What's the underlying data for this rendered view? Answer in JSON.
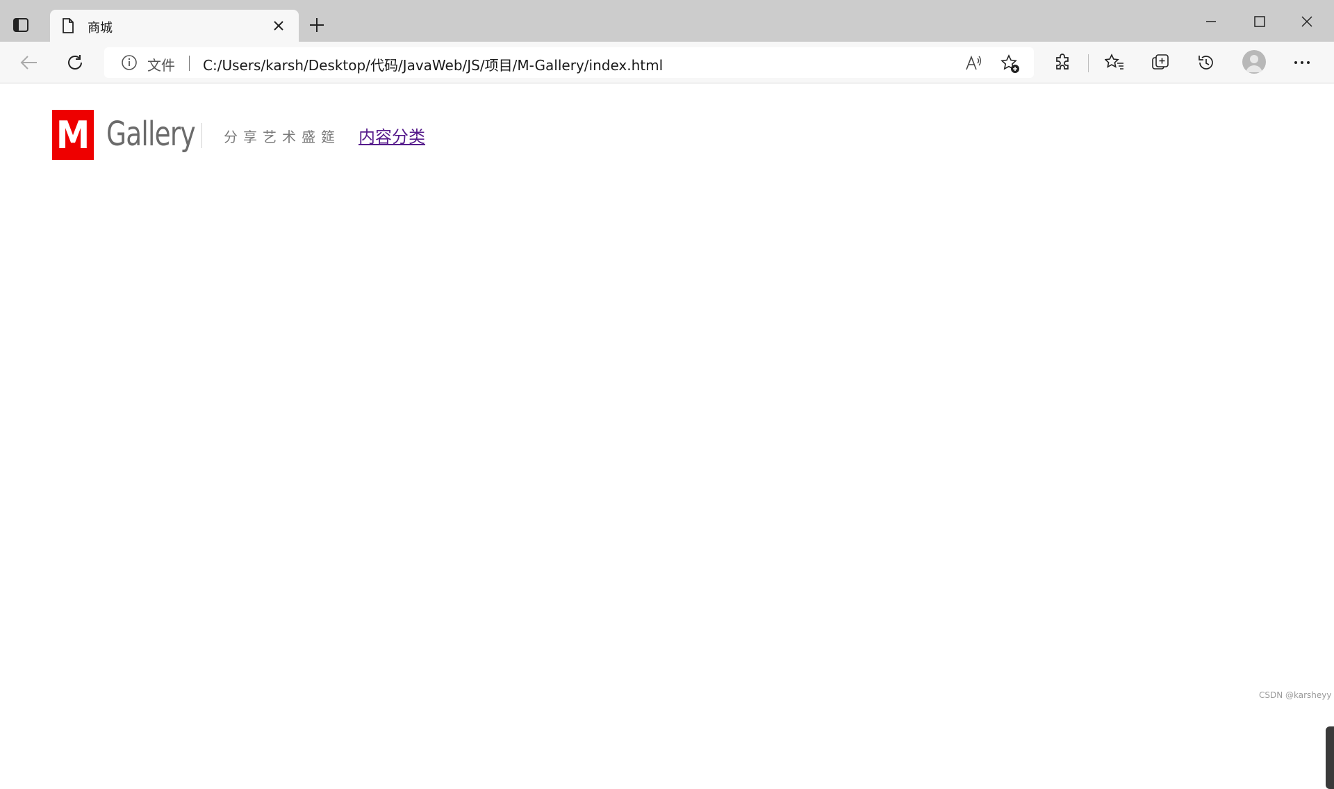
{
  "browser": {
    "tab": {
      "title": "商城"
    },
    "address_bar": {
      "scheme_label": "文件",
      "url": "C:/Users/karsh/Desktop/代码/JavaWeb/JS/项目/M-Gallery/index.html"
    },
    "icons": {
      "tab_actions": "tab-actions-icon",
      "page": "page-icon",
      "close_tab": "close-icon",
      "new_tab": "plus-icon",
      "minimize": "minimize-icon",
      "maximize": "maximize-icon",
      "close_window": "close-icon",
      "back": "back-arrow-icon",
      "refresh": "refresh-icon",
      "info": "info-icon",
      "read_aloud": "read-aloud-icon",
      "add_favorite": "add-favorite-icon",
      "extensions": "puzzle-icon",
      "favorites": "favorites-icon",
      "collections": "collections-icon",
      "history": "history-icon",
      "profile": "profile-icon",
      "more": "more-icon"
    }
  },
  "page": {
    "logo": {
      "mark": "M",
      "name": "Gallery"
    },
    "slogan": "分享艺术盛筵",
    "nav_link": "内容分类",
    "watermark": "CSDN @karsheyy"
  },
  "colors": {
    "logo_red": "#ee0000",
    "visited_link": "#551a8b",
    "tabbar_bg": "#cccccc",
    "toolbar_bg": "#f7f7f7"
  }
}
